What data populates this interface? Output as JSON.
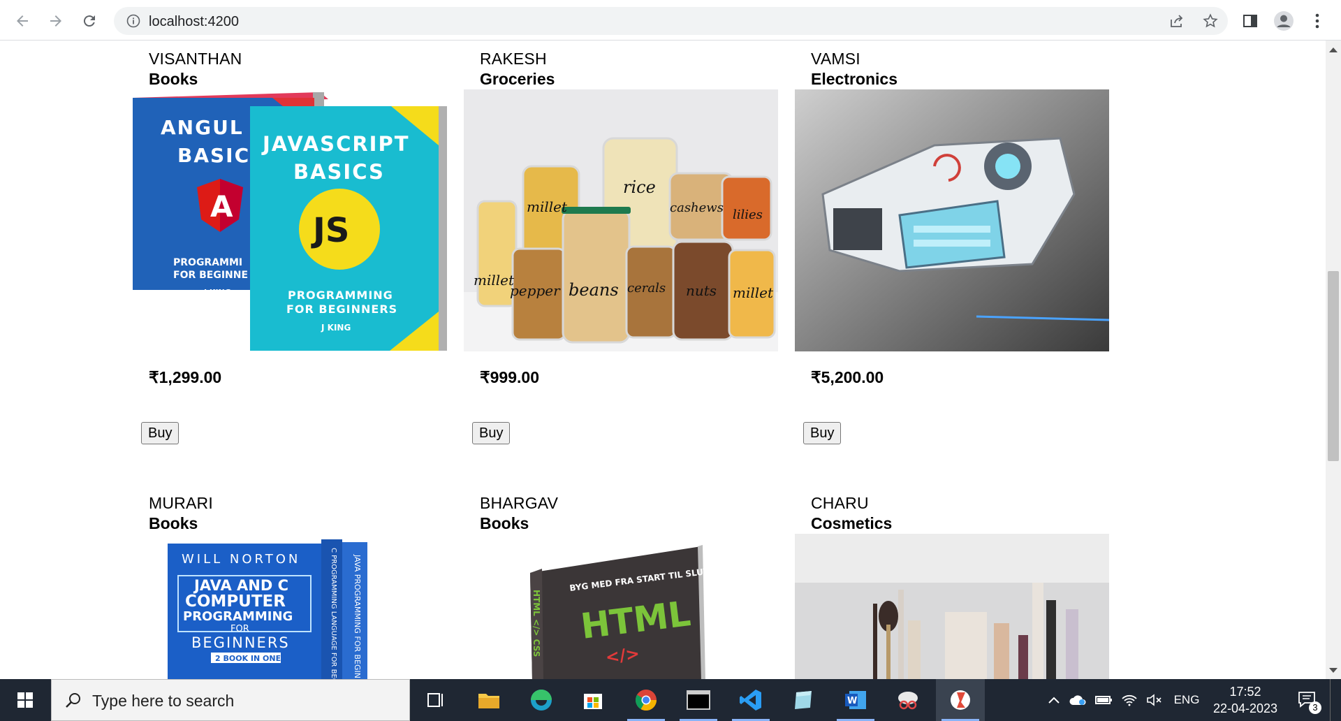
{
  "browser": {
    "url": "localhost:4200",
    "back_icon": "arrow-left-icon",
    "forward_icon": "arrow-right-icon",
    "reload_icon": "reload-icon",
    "info_icon": "info-icon",
    "share_icon": "share-icon",
    "bookmark_icon": "star-icon",
    "sidepanel_icon": "side-panel-icon",
    "profile_icon": "profile-icon",
    "menu_icon": "kebab-menu-icon"
  },
  "products": [
    {
      "seller": "VISANTHAN",
      "category": "Books",
      "price": "₹1,299.00",
      "buy_label": "Buy",
      "image": "angular-and-javascript-basics-books"
    },
    {
      "seller": "RAKESH",
      "category": "Groceries",
      "price": "₹999.00",
      "buy_label": "Buy",
      "image": "grocery-jars",
      "jar_labels": [
        "rice",
        "millet",
        "cashews",
        "lilies",
        "millet",
        "pepper",
        "beans",
        "cerals",
        "nuts",
        "millet"
      ]
    },
    {
      "seller": "VAMSI",
      "category": "Electronics",
      "price": "₹5,200.00",
      "buy_label": "Buy",
      "image": "futuristic-gadget"
    },
    {
      "seller": "MURARI",
      "category": "Books",
      "image": "java-and-c-programming-book",
      "book_text": {
        "author": "WILL NORTON",
        "title1": "JAVA AND C",
        "title2": "COMPUTER",
        "title3": "PROGRAMMING",
        "title4": "FOR",
        "title5": "BEGINNERS",
        "tag": "2 BOOK IN ONE",
        "spine1": "JAVA PROGRAMMING FOR BEGINNERS",
        "spine2": "C PROGRAMMING LANGUAGE FOR BEGINNERS"
      }
    },
    {
      "seller": "BHARGAV",
      "category": "Books",
      "image": "html-book",
      "book_text": {
        "top": "BYG MED FRA START TIL SLUT",
        "title": "HTML",
        "code": "</>",
        "spine": "HTML </> CSS"
      }
    },
    {
      "seller": "CHARU",
      "category": "Cosmetics",
      "image": "cosmetics-products"
    }
  ],
  "book1": {
    "title1": "ANGUL",
    "title2": "BASIC",
    "sub1": "PROGRAMMI",
    "sub2": "FOR BEGINNE",
    "author": "J KING"
  },
  "book2": {
    "title1": "JAVASCRIPT",
    "title2": "BASICS",
    "logo": "JS",
    "sub1": "PROGRAMMING",
    "sub2": "FOR BEGINNERS",
    "author": "J KING"
  },
  "taskbar": {
    "search_placeholder": "Type here to search",
    "time": "17:52",
    "date": "22-04-2023",
    "lang": "ENG",
    "notif_count": "3",
    "apps": [
      "task-view",
      "file-explorer",
      "edge",
      "microsoft-store",
      "chrome",
      "terminal",
      "vscode",
      "notepad",
      "word",
      "snipping-tool",
      "app-active"
    ]
  },
  "colors": {
    "accent": "#1a73e8",
    "taskbar": "#1f2733",
    "book_blue": "#2062b8",
    "book_cyan": "#19bcd0",
    "js_yellow": "#f5dc1b",
    "angular_red": "#d9322e"
  }
}
